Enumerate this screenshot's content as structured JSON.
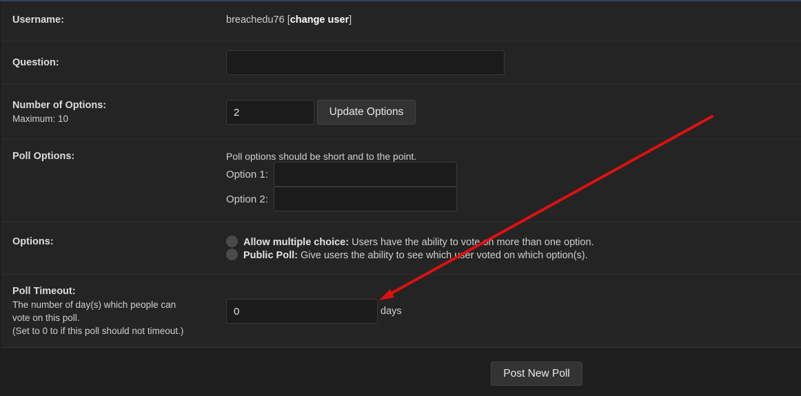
{
  "username": {
    "label": "Username:",
    "value": "breachedu76",
    "bracket_open": "[",
    "change_user": "change user",
    "bracket_close": "]"
  },
  "question": {
    "label": "Question:",
    "value": ""
  },
  "num_options": {
    "label": "Number of Options:",
    "sub": "Maximum: 10",
    "value": "2",
    "button": "Update Options"
  },
  "poll_options": {
    "label": "Poll Options:",
    "hint": "Poll options should be short and to the point.",
    "items": [
      {
        "label": "Option 1:",
        "value": ""
      },
      {
        "label": "Option 2:",
        "value": ""
      }
    ]
  },
  "options": {
    "label": "Options:",
    "items": [
      {
        "title": "Allow multiple choice:",
        "desc": "Users have the ability to vote on more than one option."
      },
      {
        "title": "Public Poll:",
        "desc": "Give users the ability to see which user voted on which option(s)."
      }
    ]
  },
  "timeout": {
    "label": "Poll Timeout:",
    "desc_lines": [
      "The number of day(s) which people can",
      "vote on this poll.",
      "(Set to 0 to if this poll should not timeout.)"
    ],
    "value": "0",
    "unit": "days"
  },
  "submit": {
    "label": "Post New Poll"
  },
  "colors": {
    "background": "#1e1e1e",
    "panel": "#242424",
    "annotation_arrow": "#e01010"
  }
}
